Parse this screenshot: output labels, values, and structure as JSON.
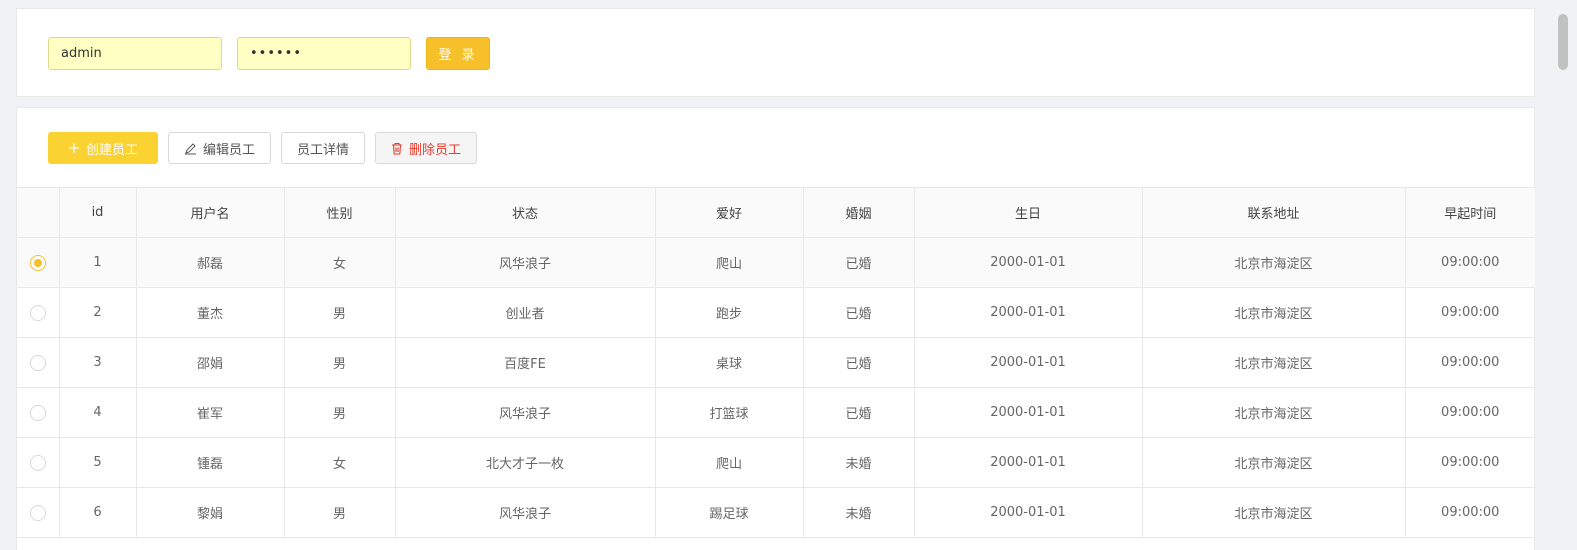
{
  "login": {
    "username": "admin",
    "password": "••••••",
    "button_label": "登 录"
  },
  "toolbar": {
    "create_label": "创建员工",
    "edit_label": "编辑员工",
    "detail_label": "员工详情",
    "delete_label": "删除员工"
  },
  "table": {
    "headers": [
      "id",
      "用户名",
      "性别",
      "状态",
      "爱好",
      "婚姻",
      "生日",
      "联系地址",
      "早起时间"
    ],
    "rows": [
      {
        "id": "1",
        "name": "郝磊",
        "gender": "女",
        "status": "风华浪子",
        "hobby": "爬山",
        "marriage": "已婚",
        "birthday": "2000-01-01",
        "address": "北京市海淀区",
        "wake": "09:00:00",
        "selected": true
      },
      {
        "id": "2",
        "name": "董杰",
        "gender": "男",
        "status": "创业者",
        "hobby": "跑步",
        "marriage": "已婚",
        "birthday": "2000-01-01",
        "address": "北京市海淀区",
        "wake": "09:00:00",
        "selected": false
      },
      {
        "id": "3",
        "name": "邵娟",
        "gender": "男",
        "status": "百度FE",
        "hobby": "桌球",
        "marriage": "已婚",
        "birthday": "2000-01-01",
        "address": "北京市海淀区",
        "wake": "09:00:00",
        "selected": false
      },
      {
        "id": "4",
        "name": "崔军",
        "gender": "男",
        "status": "风华浪子",
        "hobby": "打篮球",
        "marriage": "已婚",
        "birthday": "2000-01-01",
        "address": "北京市海淀区",
        "wake": "09:00:00",
        "selected": false
      },
      {
        "id": "5",
        "name": "锺磊",
        "gender": "女",
        "status": "北大才子一枚",
        "hobby": "爬山",
        "marriage": "未婚",
        "birthday": "2000-01-01",
        "address": "北京市海淀区",
        "wake": "09:00:00",
        "selected": false
      },
      {
        "id": "6",
        "name": "黎娟",
        "gender": "男",
        "status": "风华浪子",
        "hobby": "踢足球",
        "marriage": "未婚",
        "birthday": "2000-01-01",
        "address": "北京市海淀区",
        "wake": "09:00:00",
        "selected": false
      }
    ]
  },
  "colors": {
    "accent": "#f6c02b",
    "primary_button": "#fad232",
    "danger": "#e8392c",
    "input_bg": "#ffffc4"
  }
}
